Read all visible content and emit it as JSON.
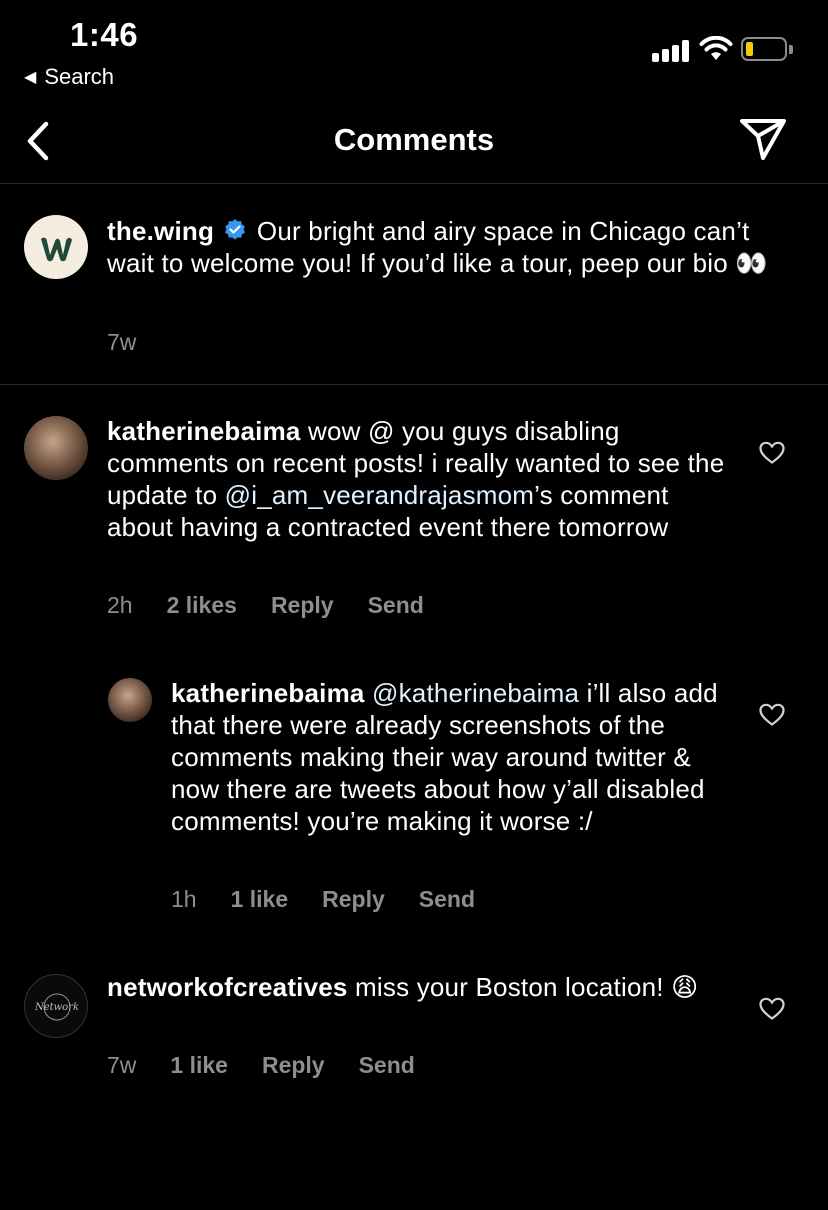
{
  "status_bar": {
    "time": "1:46",
    "back_label": "Search",
    "battery_color": "#f7cb00"
  },
  "nav": {
    "title": "Comments",
    "back_icon": "chevron-left-icon",
    "send_icon": "paper-plane-icon"
  },
  "caption": {
    "username": "the.wing",
    "verified": true,
    "text": "Our bright and airy space in Chicago can’t wait to welcome you! If you’d like a tour, peep our bio 👀",
    "time": "7w"
  },
  "comments": [
    {
      "username": "katherinebaima",
      "text_before": "wow @ you guys disabling comments on recent posts! i really wanted to see the update to ",
      "mention": "@i_am_veerandrajasmom",
      "text_after": "’s comment about having a contracted event there tomorrow",
      "time": "2h",
      "likes": "2 likes",
      "reply": "Reply",
      "send": "Send"
    },
    {
      "username": "katherinebaima",
      "mention": "@katherinebaima",
      "text_after": " i’ll also add that there were already screenshots of the comments making their way around twitter & now there are tweets about how y’all disabled comments! you’re making it worse :/",
      "time": "1h",
      "likes": "1 like",
      "reply": "Reply",
      "send": "Send"
    },
    {
      "username": "networkofcreatives",
      "text": "miss your Boston location! 😩",
      "time": "7w",
      "likes": "1 like",
      "reply": "Reply",
      "send": "Send",
      "avatar_text": "Network"
    }
  ],
  "colors": {
    "background": "#000000",
    "secondary_text": "#8e8e8e",
    "verified_blue": "#3897f0",
    "divider": "#262626"
  }
}
